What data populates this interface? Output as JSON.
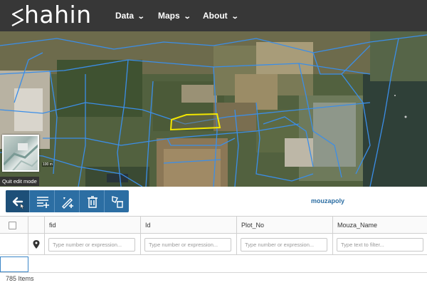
{
  "app": {
    "logo_text": "hahin",
    "nav": {
      "data_label": "Data",
      "maps_label": "Maps",
      "about_label": "About"
    }
  },
  "map": {
    "basemap_caption": "Quit edit mode",
    "scale_text": "100 m"
  },
  "toolbar": {
    "buttons": [
      "back-arrow-icon",
      "add-row-icon",
      "draw-feature-icon",
      "delete-icon",
      "delete-geometry-icon"
    ]
  },
  "layer": {
    "title": "mouzapoly"
  },
  "table": {
    "columns": [
      "fid",
      "Id",
      "Plot_No",
      "Mouza_Name"
    ],
    "filters": [
      {
        "placeholder": "Type number or expression..."
      },
      {
        "placeholder": "Type number or expression..."
      },
      {
        "placeholder": "Type number or expression..."
      },
      {
        "placeholder": "Type text to filter..."
      }
    ]
  },
  "status": {
    "items_count": "785 Items"
  },
  "colors": {
    "navbar": "#373737",
    "accent": "#2c6ea3",
    "parcel_line": "#3b8ee8",
    "selected_parcel": "#f2e600"
  }
}
